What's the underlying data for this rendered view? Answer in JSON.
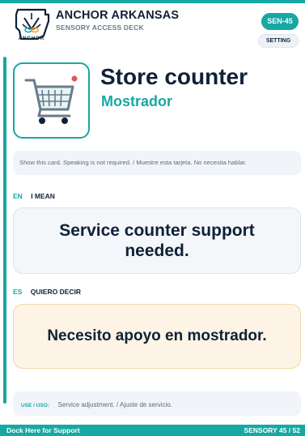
{
  "header": {
    "org_name": "ANCHOR ARKANSAS",
    "deck_name": "SENSORY ACCESS DECK",
    "logo_word": "ANCHOR",
    "card_id": "SEN-45",
    "setting_label": "SETTING"
  },
  "card": {
    "icon": "shopping-cart-icon",
    "title_en": "Store counter",
    "title_es": "Mostrador",
    "instruction": "Show this card. Speaking is not required. / Muestre esta tarjeta. No necesita hablar."
  },
  "sections": [
    {
      "code": "EN",
      "heading": "I MEAN",
      "phrase": "Service counter support needed."
    },
    {
      "code": "ES",
      "heading": "QUIERO DECIR",
      "phrase": "Necesito apoyo en mostrador."
    }
  ],
  "use": {
    "label": "USE / USO:",
    "text": "Service adjustment. / Ajuste de servicio."
  },
  "footer": {
    "left": "Dock Here for Support",
    "right": "SENSORY 45 / 52"
  },
  "colors": {
    "accent": "#17a8a3",
    "navy": "#0f2137",
    "es_card": "#fdf4e5"
  }
}
